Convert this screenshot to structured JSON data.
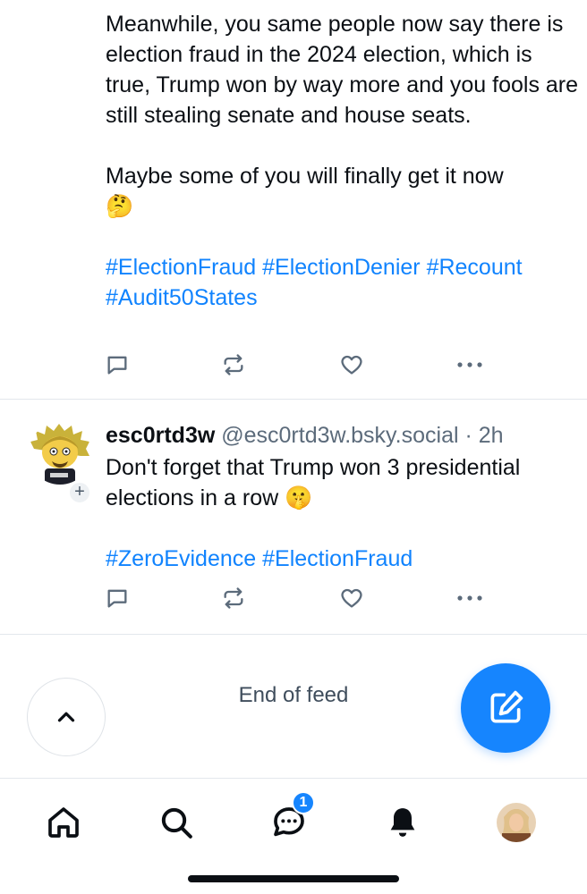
{
  "post1": {
    "text": "Meanwhile, you same people now say there is election fraud in the 2024 election, which is true, Trump won by way more and you fools are still stealing senate and house seats.\n\nMaybe some of you will finally get it now\n🤔",
    "hashtags": [
      "#ElectionFraud",
      "#ElectionDenier",
      "#Recount",
      "#Audit50States"
    ]
  },
  "post2": {
    "display_name": "esc0rtd3w",
    "handle": "@esc0rtd3w.bsky.social",
    "separator": " · ",
    "time": "2h",
    "text": "Don't forget that Trump won 3 presidential elections in a row 🤫",
    "hashtags": [
      "#ZeroEvidence",
      "#ElectionFraud"
    ]
  },
  "feed": {
    "end_text": "End of feed"
  },
  "tabbar": {
    "notifications_badge": "1",
    "items": [
      "home-icon",
      "search-icon",
      "chat-icon",
      "bell-icon",
      "profile-avatar"
    ]
  },
  "colors": {
    "accent": "#1083fe",
    "text": "#0b0f14",
    "muted": "#5c6b7b",
    "divider": "#e3e7ec"
  }
}
